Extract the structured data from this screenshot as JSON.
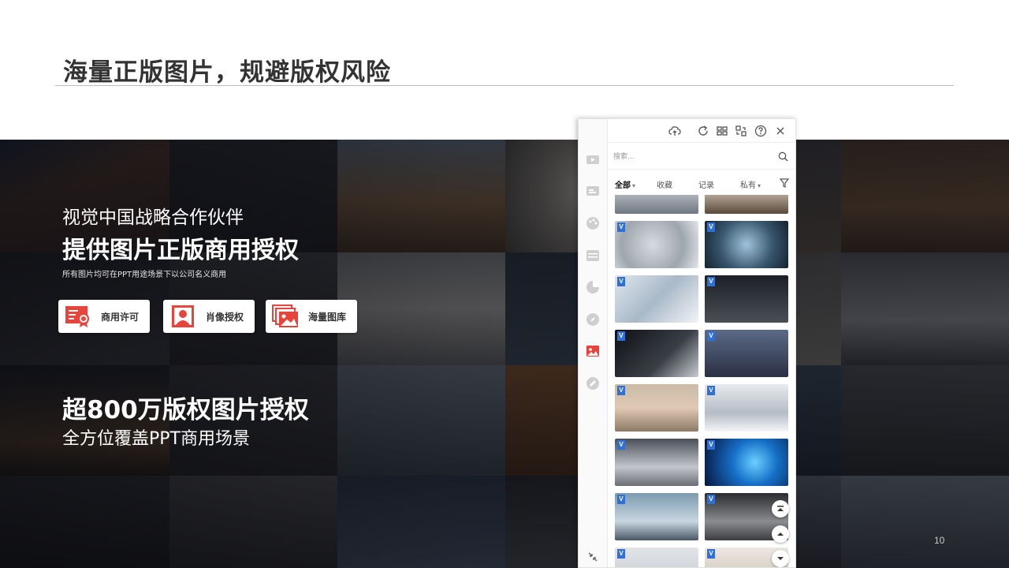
{
  "slide": {
    "title": "海量正版图片，规避版权风险",
    "page_number": "10"
  },
  "overlay": {
    "partner": "视觉中国战略合作伙伴",
    "license": "提供图片正版商用授权",
    "note": "所有图片均可在PPT用途场景下以公司名义商用",
    "features": [
      {
        "label": "商用许可",
        "icon": "certificate-icon"
      },
      {
        "label": "肖像授权",
        "icon": "portrait-icon"
      },
      {
        "label": "海量图库",
        "icon": "gallery-icon"
      }
    ],
    "count_headline": "超800万版权图片授权",
    "coverage": "全方位覆盖PPT商用场景"
  },
  "panel": {
    "toolbar_icons": [
      "cloud-upload-icon",
      "refresh-icon",
      "grid-view-icon",
      "swap-icon",
      "help-icon",
      "close-icon"
    ],
    "search": {
      "placeholder": "搜索...",
      "value": ""
    },
    "filters": [
      {
        "label": "全部",
        "active": true,
        "dropdown": true
      },
      {
        "label": "收藏",
        "active": false,
        "dropdown": false
      },
      {
        "label": "记录",
        "active": false,
        "dropdown": false
      },
      {
        "label": "私有",
        "active": false,
        "dropdown": true
      }
    ],
    "rail_icons": [
      "video-icon",
      "card-icon",
      "palette-icon",
      "table-icon",
      "pie-chart-icon",
      "compass-icon",
      "image-icon",
      "edit-icon",
      "collapse-icon"
    ],
    "active_rail_icon": "image-icon",
    "badge_letter": "V",
    "float_buttons": [
      "scroll-top-icon",
      "scroll-up-icon",
      "scroll-down-icon"
    ],
    "accent": "#e8443c",
    "badge_color": "#2f6fd6"
  }
}
